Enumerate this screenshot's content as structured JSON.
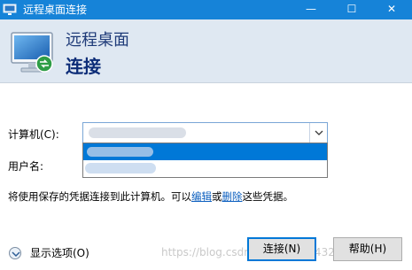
{
  "window": {
    "title": "远程桌面连接",
    "minimize_glyph": "—",
    "maximize_glyph": "☐",
    "close_glyph": "✕"
  },
  "header": {
    "line1": "远程桌面",
    "line2": "连接"
  },
  "form": {
    "computer_label": "计算机(C):",
    "computer_value": "",
    "username_label": "用户名:",
    "dropdown_options": [
      "",
      ""
    ]
  },
  "info": {
    "text_before": "将使用保存的凭据连接到此计算机。可以",
    "edit_link": "编辑",
    "middle": "或",
    "delete_link": "删除",
    "text_after": "这些凭据。"
  },
  "footer": {
    "show_options": "显示选项(O)",
    "connect_button": "连接(N)",
    "help_button": "帮助(H)"
  },
  "watermark": "https://blog.csdn.net/weixin_43271498",
  "colors": {
    "titlebar": "#1683d8",
    "header_bg": "#dfe8f2",
    "header_text": "#0d2d78",
    "selection": "#0078d7",
    "link": "#0c5fbf"
  },
  "icons": {
    "app": "remote-desktop-icon",
    "header": "monitor-icon",
    "dropdown": "chevron-down-icon",
    "options": "chevron-down-circle-icon"
  }
}
